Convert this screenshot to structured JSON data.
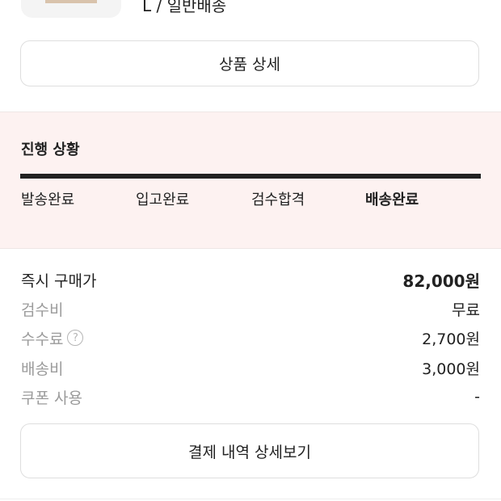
{
  "product": {
    "option_text": "L / 일반배송"
  },
  "buttons": {
    "product_detail": "상품 상세",
    "payment_detail": "결제 내역 상세보기"
  },
  "progress": {
    "title": "진행 상황",
    "steps": [
      "발송완료",
      "입고완료",
      "검수합격",
      "배송완료"
    ],
    "current_step_index": 3,
    "fraction_complete": 1.0
  },
  "price": {
    "rows": [
      {
        "label": "즉시 구매가",
        "value": "82,000원"
      },
      {
        "label": "검수비",
        "value": "무료"
      },
      {
        "label": "수수료",
        "value": "2,700원",
        "help_icon": "?"
      },
      {
        "label": "배송비",
        "value": "3,000원"
      },
      {
        "label": "쿠폰 사용",
        "value": "-"
      }
    ]
  },
  "colors": {
    "progress_bg": "#fdf2f1",
    "progress_fill": "#222222",
    "muted_text": "#9b9b9b"
  }
}
